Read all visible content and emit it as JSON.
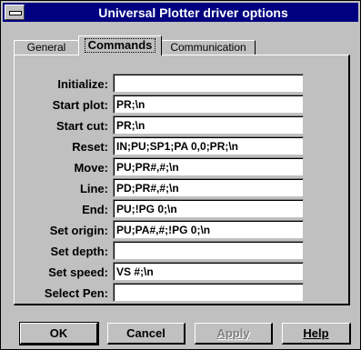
{
  "window": {
    "title": "Universal Plotter driver options"
  },
  "tabs": [
    {
      "label": "General"
    },
    {
      "label": "Commands"
    },
    {
      "label": "Communication"
    }
  ],
  "fields": [
    {
      "label": "Initialize:",
      "value": ""
    },
    {
      "label": "Start plot:",
      "value": "PR;\\n"
    },
    {
      "label": "Start cut:",
      "value": "PR;\\n"
    },
    {
      "label": "Reset:",
      "value": "IN;PU;SP1;PA 0,0;PR;\\n"
    },
    {
      "label": "Move:",
      "value": "PU;PR#,#;\\n"
    },
    {
      "label": "Line:",
      "value": "PD;PR#,#;\\n"
    },
    {
      "label": "End:",
      "value": "PU;!PG 0;\\n"
    },
    {
      "label": "Set origin:",
      "value": "PU;PA#,#;!PG 0;\\n"
    },
    {
      "label": "Set depth:",
      "value": ""
    },
    {
      "label": "Set speed:",
      "value": "VS #;\\n"
    },
    {
      "label": "Select Pen:",
      "value": ""
    }
  ],
  "buttons": {
    "ok": "OK",
    "cancel": "Cancel",
    "apply": "Apply",
    "help": "Help"
  }
}
